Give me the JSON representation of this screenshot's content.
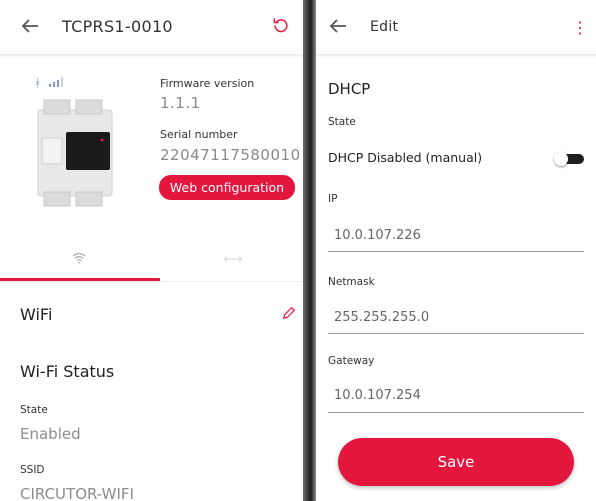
{
  "left": {
    "title": "TCPRS1-0010",
    "back_icon": "arrow-left-icon",
    "refresh_icon": "refresh-icon",
    "device_image_icon": "din-rail-device",
    "status_icons": [
      "bluetooth-icon",
      "signal-bars-icon"
    ],
    "firmware_label": "Firmware version",
    "firmware_value": "1.1.1",
    "serial_label": "Serial number",
    "serial_value": "22047117580010",
    "web_config_label": "Web configuration",
    "tabs": [
      {
        "icon": "wifi-icon",
        "active": true
      },
      {
        "icon": "ethernet-arrows-icon",
        "active": false
      }
    ],
    "wifi_section_title": "WiFi",
    "edit_icon": "pencil-icon",
    "wifi_status_title": "Wi-Fi Status",
    "state_label": "State",
    "state_value": "Enabled",
    "ssid_label": "SSID",
    "ssid_value": "CIRCUTOR-WIFI"
  },
  "right": {
    "title": "Edit",
    "back_icon": "arrow-left-icon",
    "menu_icon": "vertical-dots-icon",
    "section_title": "DHCP",
    "state_label": "State",
    "dhcp_toggle_label": "DHCP Disabled (manual)",
    "dhcp_enabled": false,
    "ip_label": "IP",
    "ip_value": "10.0.107.226",
    "netmask_label": "Netmask",
    "netmask_value": "255.255.255.0",
    "gateway_label": "Gateway",
    "gateway_value": "10.0.107.254",
    "save_label": "Save"
  },
  "colors": {
    "accent": "#e3173e",
    "muted_text": "#8d8d8d",
    "bluetooth": "#7a98c9"
  }
}
